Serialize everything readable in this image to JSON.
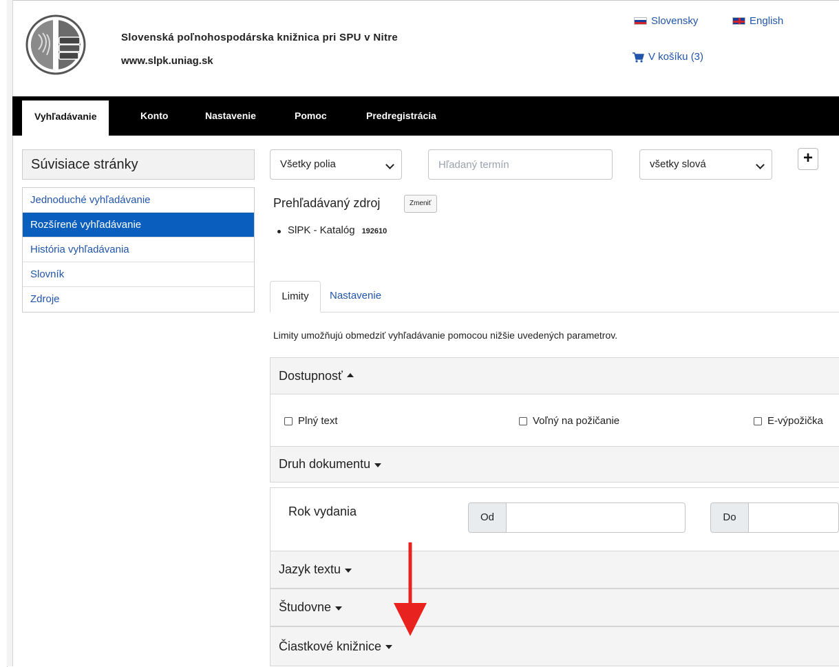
{
  "header": {
    "title": "Slovenská poľnohospodárska knižnica pri SPU v Nitre",
    "url": "www.slpk.uniag.sk",
    "lang_sk": "Slovensky",
    "lang_en": "English",
    "cart": "V košíku (3)"
  },
  "nav": {
    "items": [
      "Vyhľadávanie",
      "Konto",
      "Nastavenie",
      "Pomoc",
      "Predregistrácia"
    ],
    "active": "Vyhľadávanie"
  },
  "sidebar": {
    "title": "Súvisiace stránky",
    "items": [
      "Jednoduché vyhľadávanie",
      "Rozšírené vyhľadávanie",
      "História vyhľadávania",
      "Slovník",
      "Zdroje"
    ],
    "active": "Rozšírené vyhľadávanie"
  },
  "search": {
    "field_select": "Všetky polia",
    "term_placeholder": "Hľadaný termín",
    "mode_select": "všetky slová",
    "add_label": "+"
  },
  "source": {
    "label": "Prehľadávaný zdroj",
    "change": "Zmeniť",
    "item_name": "SlPK - Katalóg",
    "item_count": "192610"
  },
  "tabs": {
    "limits": "Limity",
    "settings": "Nastavenie"
  },
  "limits": {
    "description": "Limity umožňujú obmedziť vyhľadávanie pomocou nižšie uvedených parametrov.",
    "availability": "Dostupnosť",
    "full_text": "Plný text",
    "free_loan": "Voľný na požičanie",
    "e_loan": "E-výpožička",
    "doc_type": "Druh dokumentu",
    "year": "Rok vydania",
    "from": "Od",
    "to": "Do",
    "language": "Jazyk textu",
    "study_rooms": "Študovne",
    "branches": "Čiastkové knižnice"
  },
  "colors": {
    "nav_bg": "#000000",
    "link": "#2255aa",
    "active_item": "#0a5ebd",
    "annotation_arrow": "#e8231f"
  },
  "icons": [
    "logo-icon",
    "slovak-flag-icon",
    "english-flag-icon",
    "cart-icon",
    "chevron-down-icon",
    "plus-icon",
    "triangle-up-icon",
    "triangle-down-icon",
    "checkbox-icon",
    "red-arrow-annotation"
  ]
}
